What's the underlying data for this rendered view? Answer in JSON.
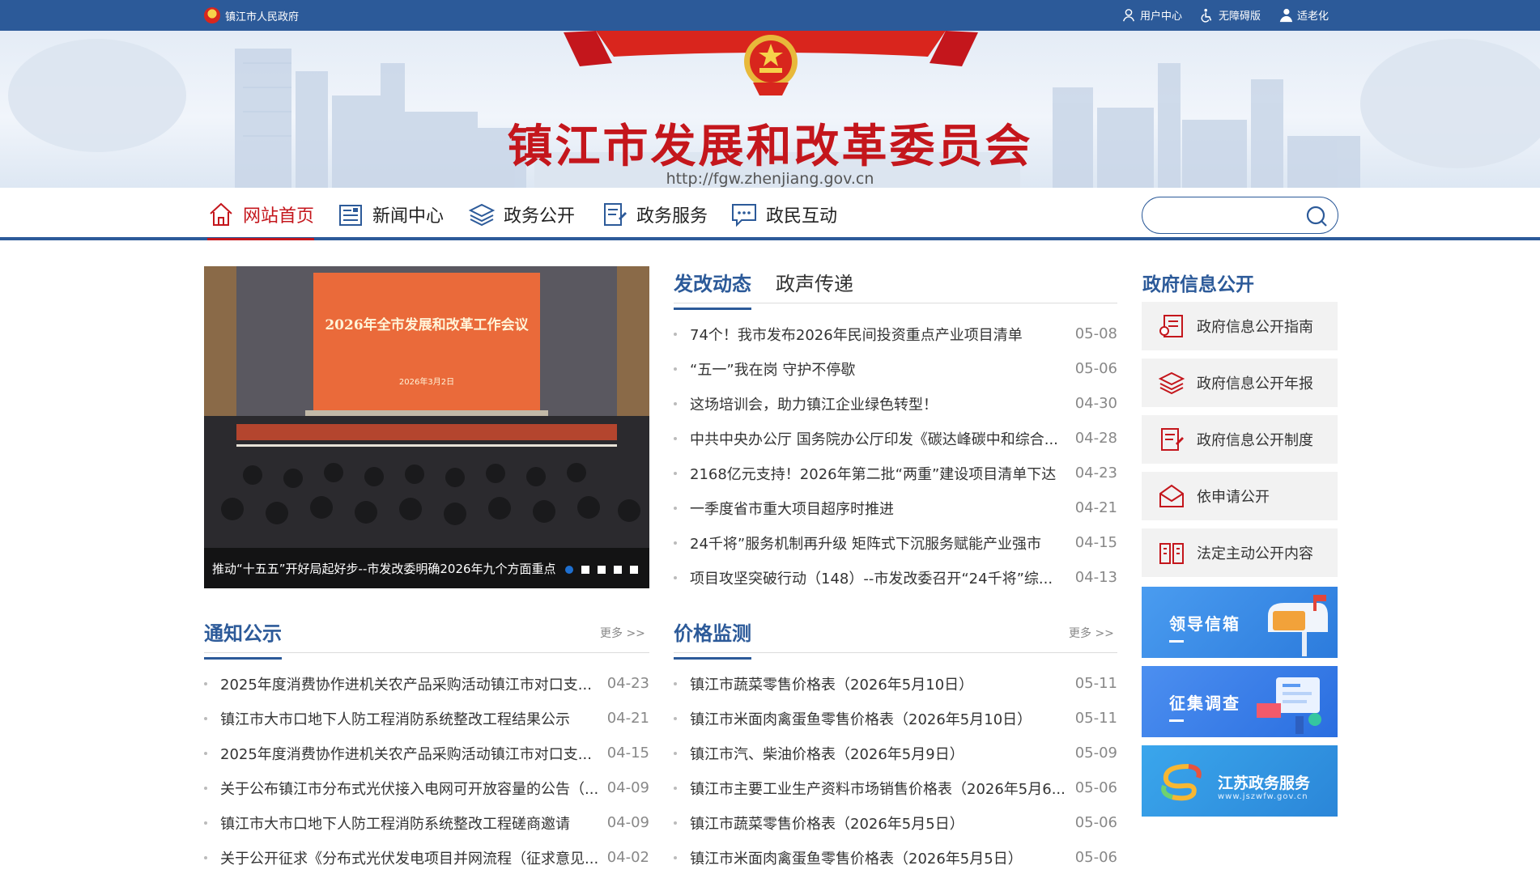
{
  "topbar": {
    "site_name": "镇江市人民政府",
    "links": [
      {
        "label": "用户中心",
        "icon": "user-icon"
      },
      {
        "label": "无障碍版",
        "icon": "accessibility-icon"
      },
      {
        "label": "适老化",
        "icon": "elderly-icon"
      }
    ]
  },
  "banner": {
    "title": "镇江市发展和改革委员会",
    "url": "http://fgw.zhenjiang.gov.cn"
  },
  "nav": {
    "items": [
      {
        "label": "网站首页",
        "icon": "home-icon"
      },
      {
        "label": "新闻中心",
        "icon": "news-icon"
      },
      {
        "label": "政务公开",
        "icon": "layers-icon"
      },
      {
        "label": "政务服务",
        "icon": "document-pen-icon"
      },
      {
        "label": "政民互动",
        "icon": "chat-icon"
      }
    ],
    "search_placeholder": ""
  },
  "carousel": {
    "slide_title": "2026年全市发展和改革工作会议",
    "slide_date": "2026年3月2日",
    "caption": "推动“十五五”开好局起好步--市发改委明确2026年九个方面重点",
    "active_dot": 0,
    "dot_count": 5
  },
  "news": {
    "tabs": [
      "发改动态",
      "政声传递"
    ],
    "items": [
      {
        "title": "74个！我市发布2026年民间投资重点产业项目清单",
        "date": "05-08"
      },
      {
        "title": "“五一”我在岗 守护不停歇",
        "date": "05-06"
      },
      {
        "title": "这场培训会，助力镇江企业绿色转型！",
        "date": "04-30"
      },
      {
        "title": "中共中央办公厅 国务院办公厅印发《碳达峰碳中和综合...",
        "date": "04-28"
      },
      {
        "title": "2168亿元支持！2026年第二批“两重”建设项目清单下达",
        "date": "04-23"
      },
      {
        "title": "一季度省市重大项目超序时推进",
        "date": "04-21"
      },
      {
        "title": "24千将”服务机制再升级 矩阵式下沉服务赋能产业强市",
        "date": "04-15"
      },
      {
        "title": "项目攻坚突破行动（148）--市发改委召开“24千将”综...",
        "date": "04-13"
      }
    ]
  },
  "notice": {
    "title": "通知公示",
    "more": "更多 >>",
    "items": [
      {
        "title": "2025年度消费协作进机关农产品采购活动镇江市对口支...",
        "date": "04-23"
      },
      {
        "title": "镇江市大市口地下人防工程消防系统整改工程结果公示",
        "date": "04-21"
      },
      {
        "title": "2025年度消费协作进机关农产品采购活动镇江市对口支...",
        "date": "04-15"
      },
      {
        "title": "关于公布镇江市分布式光伏接入电网可开放容量的公告（...",
        "date": "04-09"
      },
      {
        "title": "镇江市大市口地下人防工程消防系统整改工程磋商邀请",
        "date": "04-09"
      },
      {
        "title": "关于公开征求《分布式光伏发电项目并网流程（征求意见...",
        "date": "04-02"
      }
    ]
  },
  "price": {
    "title": "价格监测",
    "more": "更多 >>",
    "items": [
      {
        "title": "镇江市蔬菜零售价格表（2026年5月10日）",
        "date": "05-11"
      },
      {
        "title": "镇江市米面肉禽蛋鱼零售价格表（2026年5月10日）",
        "date": "05-11"
      },
      {
        "title": "镇江市汽、柴油价格表（2026年5月9日）",
        "date": "05-09"
      },
      {
        "title": "镇江市主要工业生产资料市场销售价格表（2026年5月6...",
        "date": "05-06"
      },
      {
        "title": "镇江市蔬菜零售价格表（2026年5月5日）",
        "date": "05-06"
      },
      {
        "title": "镇江市米面肉禽蛋鱼零售价格表（2026年5月5日）",
        "date": "05-06"
      }
    ]
  },
  "gov_info": {
    "title": "政府信息公开",
    "items": [
      {
        "label": "政府信息公开指南",
        "icon": "guide-icon"
      },
      {
        "label": "政府信息公开年报",
        "icon": "layers-icon"
      },
      {
        "label": "政府信息公开制度",
        "icon": "document-pen-icon"
      },
      {
        "label": "依申请公开",
        "icon": "envelope-icon"
      },
      {
        "label": "法定主动公开内容",
        "icon": "book-icon"
      }
    ]
  },
  "promos": [
    {
      "label": "领导信箱",
      "color": "#3f8fe0"
    },
    {
      "label": "征集调查",
      "color": "#3a7fe0"
    },
    {
      "label": "江苏政务服务",
      "sub": "www.jszwfw.gov.cn",
      "color": "#2f9fe8"
    }
  ],
  "colors": {
    "primary": "#2c5a99",
    "accent": "#c4161c"
  }
}
